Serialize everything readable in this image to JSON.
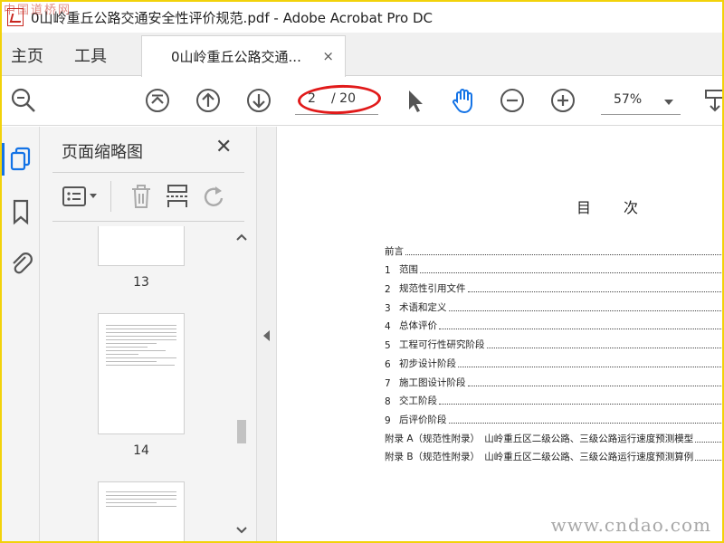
{
  "watermark_top": "中国道桥网",
  "window": {
    "title": "0山岭重丘公路交通安全性评价规范.pdf - Adobe Acrobat Pro DC"
  },
  "menu": {
    "home": "主页",
    "tools": "工具"
  },
  "tab": {
    "label": "0山岭重丘公路交通...",
    "close": "×"
  },
  "toolbar": {
    "page_current": "2",
    "page_total": "/ 20",
    "zoom": "57%",
    "icons": [
      "search-zoom-icon",
      "first-page-icon",
      "prev-page-icon",
      "next-page-icon",
      "select-arrow-icon",
      "hand-icon",
      "zoom-out-icon",
      "zoom-in-icon",
      "scroll-mode-icon"
    ]
  },
  "panel": {
    "title": "页面缩略图",
    "close": "✕",
    "thumbnails": [
      {
        "label": "13"
      },
      {
        "label": "14"
      }
    ]
  },
  "document": {
    "heading": "目次",
    "toc": [
      {
        "num": "",
        "text": "前言"
      },
      {
        "num": "1",
        "text": "范围"
      },
      {
        "num": "2",
        "text": "规范性引用文件"
      },
      {
        "num": "3",
        "text": "术语和定义"
      },
      {
        "num": "4",
        "text": "总体评价"
      },
      {
        "num": "5",
        "text": "工程可行性研究阶段"
      },
      {
        "num": "6",
        "text": "初步设计阶段"
      },
      {
        "num": "7",
        "text": "施工图设计阶段"
      },
      {
        "num": "8",
        "text": "交工阶段"
      },
      {
        "num": "9",
        "text": "后评价阶段"
      },
      {
        "num": "",
        "text": "附录 A（规范性附录）　山岭重丘区二级公路、三级公路运行速度预测模型"
      },
      {
        "num": "",
        "text": "附录 B（规范性附录）　山岭重丘区二级公路、三级公路运行速度预测算例"
      }
    ]
  },
  "watermark_bottom": "www.cndao.com",
  "colors": {
    "accent": "#1473e6",
    "annotation": "#e11a1a",
    "frame": "#f2d20a"
  }
}
